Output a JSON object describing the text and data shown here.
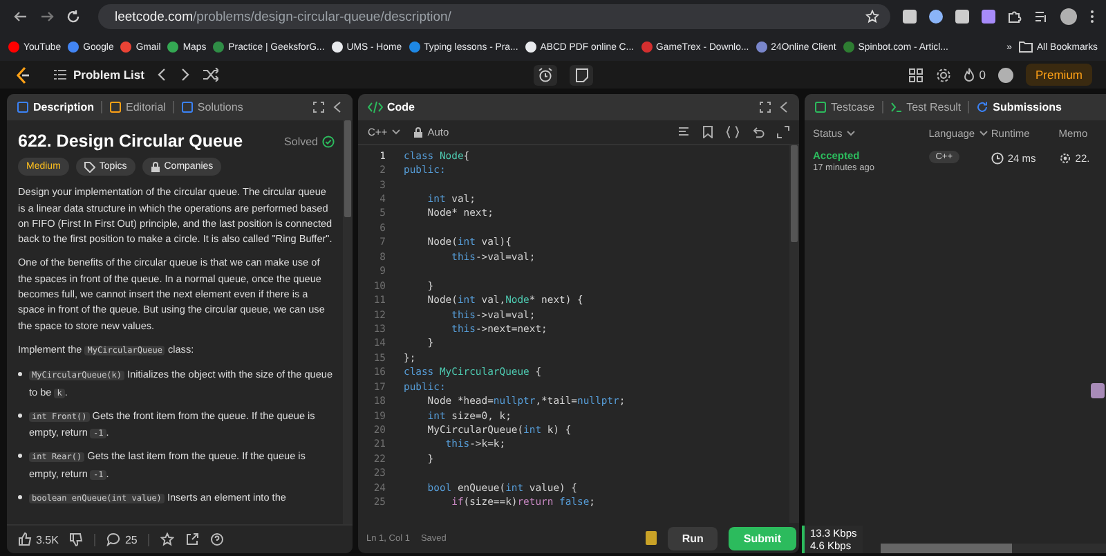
{
  "browser": {
    "url_host": "leetcode.com",
    "url_path": "/problems/design-circular-queue/description/",
    "bookmarks": [
      {
        "label": "YouTube",
        "color": "#ff0000"
      },
      {
        "label": "Google",
        "color": "#4285f4"
      },
      {
        "label": "Gmail",
        "color": "#ea4335"
      },
      {
        "label": "Maps",
        "color": "#34a853"
      },
      {
        "label": "Practice | GeeksforG...",
        "color": "#2f8d46"
      },
      {
        "label": "UMS - Home",
        "color": "#e8eaed"
      },
      {
        "label": "Typing lessons - Pra...",
        "color": "#1e88e5"
      },
      {
        "label": "ABCD PDF online C...",
        "color": "#e8eaed"
      },
      {
        "label": "GameTrex - Downlo...",
        "color": "#d32f2f"
      },
      {
        "label": "24Online Client",
        "color": "#7986cb"
      },
      {
        "label": "Spinbot.com - Articl...",
        "color": "#2e7d32"
      }
    ],
    "more": "»",
    "all_bookmarks": "All Bookmarks"
  },
  "nav": {
    "problem_list": "Problem List",
    "streak": "0",
    "premium": "Premium"
  },
  "description": {
    "tabs": [
      {
        "label": "Description",
        "selected": true
      },
      {
        "label": "Editorial",
        "selected": false
      },
      {
        "label": "Solutions",
        "selected": false
      }
    ],
    "title": "622. Design Circular Queue",
    "status": "Solved",
    "tags": [
      {
        "label": "Medium",
        "kind": "difficulty"
      },
      {
        "label": "Topics",
        "kind": "topics"
      },
      {
        "label": "Companies",
        "kind": "companies"
      }
    ],
    "blocks": [
      {
        "kind": "p",
        "parts": [
          {
            "t": "Design your implementation of the circular queue. The circular queue is a linear data structure in which the operations are performed based on FIFO (First In First Out) principle, and the last position is connected back to the first position to make a circle. It is also called \"Ring Buffer\".",
            "kind": "text"
          }
        ]
      },
      {
        "kind": "p",
        "parts": [
          {
            "t": "One of the benefits of the circular queue is that we can make use of the spaces in front of the queue. In a normal queue, once the queue becomes full, we cannot insert the next element even if there is a space in front of the queue. But using the circular queue, we can use the space to store new values.",
            "kind": "text"
          }
        ]
      },
      {
        "kind": "p",
        "parts": [
          {
            "t": "Implement the ",
            "kind": "text"
          },
          {
            "t": "MyCircularQueue",
            "kind": "code"
          },
          {
            "t": " class:",
            "kind": "text"
          }
        ]
      },
      {
        "kind": "li",
        "parts": [
          {
            "t": "MyCircularQueue(k)",
            "kind": "code"
          },
          {
            "t": " Initializes the object with the size of the queue to be ",
            "kind": "text"
          },
          {
            "t": "k",
            "kind": "code"
          },
          {
            "t": ".",
            "kind": "text"
          }
        ]
      },
      {
        "kind": "li",
        "parts": [
          {
            "t": "int Front()",
            "kind": "code"
          },
          {
            "t": " Gets the front item from the queue. If the queue is empty, return ",
            "kind": "text"
          },
          {
            "t": "-1",
            "kind": "code"
          },
          {
            "t": ".",
            "kind": "text"
          }
        ]
      },
      {
        "kind": "li",
        "parts": [
          {
            "t": "int Rear()",
            "kind": "code"
          },
          {
            "t": " Gets the last item from the queue. If the queue is empty, return ",
            "kind": "text"
          },
          {
            "t": "-1",
            "kind": "code"
          },
          {
            "t": ".",
            "kind": "text"
          }
        ]
      },
      {
        "kind": "li",
        "parts": [
          {
            "t": "boolean enQueue(int value)",
            "kind": "code"
          },
          {
            "t": " Inserts an element into the",
            "kind": "text"
          }
        ]
      }
    ],
    "likes": "3.5K",
    "comments": "25"
  },
  "code": {
    "title": "Code",
    "language": "C++",
    "mode": "Auto",
    "lines": [
      {
        "n": "1",
        "selected": true,
        "tokens": [
          {
            "t": "class ",
            "kind": "kw"
          },
          {
            "t": "Node",
            "kind": "type"
          },
          {
            "t": "{",
            "kind": "p"
          }
        ]
      },
      {
        "n": "2",
        "selected": false,
        "tokens": [
          {
            "t": "public:",
            "kind": "kw"
          }
        ]
      },
      {
        "n": "3",
        "selected": false
      },
      {
        "n": "4",
        "selected": false,
        "tokens": [
          {
            "t": "    int ",
            "kind": "kw"
          },
          {
            "t": "val;",
            "kind": "p"
          }
        ]
      },
      {
        "n": "5",
        "selected": false,
        "tokens": [
          {
            "t": "    Node* next;",
            "kind": "p"
          }
        ]
      },
      {
        "n": "6",
        "selected": false
      },
      {
        "n": "7",
        "selected": false,
        "tokens": [
          {
            "t": "    Node(",
            "kind": "p"
          },
          {
            "t": "int ",
            "kind": "kw"
          },
          {
            "t": "val){",
            "kind": "p"
          }
        ]
      },
      {
        "n": "8",
        "selected": false,
        "tokens": [
          {
            "t": "        this",
            "kind": "kw"
          },
          {
            "t": "->val=val;",
            "kind": "p"
          }
        ]
      },
      {
        "n": "9",
        "selected": false
      },
      {
        "n": "10",
        "selected": false,
        "tokens": [
          {
            "t": "    }",
            "kind": "p"
          }
        ]
      },
      {
        "n": "11",
        "selected": false,
        "tokens": [
          {
            "t": "    Node(",
            "kind": "p"
          },
          {
            "t": "int ",
            "kind": "kw"
          },
          {
            "t": "val,",
            "kind": "p"
          },
          {
            "t": "Node",
            "kind": "type"
          },
          {
            "t": "* next) {",
            "kind": "p"
          }
        ]
      },
      {
        "n": "12",
        "selected": false,
        "tokens": [
          {
            "t": "        this",
            "kind": "kw"
          },
          {
            "t": "->val=val;",
            "kind": "p"
          }
        ]
      },
      {
        "n": "13",
        "selected": false,
        "tokens": [
          {
            "t": "        this",
            "kind": "kw"
          },
          {
            "t": "->next=next;",
            "kind": "p"
          }
        ]
      },
      {
        "n": "14",
        "selected": false,
        "tokens": [
          {
            "t": "    }",
            "kind": "p"
          }
        ]
      },
      {
        "n": "15",
        "selected": false,
        "tokens": [
          {
            "t": "};",
            "kind": "p"
          }
        ]
      },
      {
        "n": "16",
        "selected": false,
        "tokens": [
          {
            "t": "class ",
            "kind": "kw"
          },
          {
            "t": "MyCircularQueue",
            "kind": "type"
          },
          {
            "t": " {",
            "kind": "p"
          }
        ]
      },
      {
        "n": "17",
        "selected": false,
        "tokens": [
          {
            "t": "public:",
            "kind": "kw"
          }
        ]
      },
      {
        "n": "18",
        "selected": false,
        "tokens": [
          {
            "t": "    Node *head=",
            "kind": "p"
          },
          {
            "t": "nullptr",
            "kind": "kw"
          },
          {
            "t": ",*tail=",
            "kind": "p"
          },
          {
            "t": "nullptr",
            "kind": "kw"
          },
          {
            "t": ";",
            "kind": "p"
          }
        ]
      },
      {
        "n": "19",
        "selected": false,
        "tokens": [
          {
            "t": "    int ",
            "kind": "kw"
          },
          {
            "t": "size=0, k;",
            "kind": "p"
          }
        ]
      },
      {
        "n": "20",
        "selected": false,
        "tokens": [
          {
            "t": "    MyCircularQueue(",
            "kind": "p"
          },
          {
            "t": "int ",
            "kind": "kw"
          },
          {
            "t": "k) {",
            "kind": "p"
          }
        ]
      },
      {
        "n": "21",
        "selected": false,
        "tokens": [
          {
            "t": "       this",
            "kind": "kw"
          },
          {
            "t": "->k=k;",
            "kind": "p"
          }
        ]
      },
      {
        "n": "22",
        "selected": false,
        "tokens": [
          {
            "t": "    }",
            "kind": "p"
          }
        ]
      },
      {
        "n": "23",
        "selected": false
      },
      {
        "n": "24",
        "selected": false,
        "tokens": [
          {
            "t": "    bool ",
            "kind": "kw"
          },
          {
            "t": "enQueue(",
            "kind": "p"
          },
          {
            "t": "int ",
            "kind": "kw"
          },
          {
            "t": "value) {",
            "kind": "p"
          }
        ]
      },
      {
        "n": "25",
        "selected": false,
        "tokens": [
          {
            "t": "        if",
            "kind": "ctrl"
          },
          {
            "t": "(size==k)",
            "kind": "p"
          },
          {
            "t": "return ",
            "kind": "ctrl"
          },
          {
            "t": "false",
            "kind": "kw"
          },
          {
            "t": ";",
            "kind": "p"
          }
        ]
      }
    ],
    "cursor": "Ln 1, Col 1",
    "saved": "Saved",
    "run": "Run",
    "submit": "Submit"
  },
  "results": {
    "tabs": [
      {
        "label": "Testcase",
        "selected": false
      },
      {
        "label": "Test Result",
        "selected": false
      },
      {
        "label": "Submissions",
        "selected": true
      }
    ],
    "columns": [
      "Status",
      "Language",
      "Runtime",
      "Memo"
    ],
    "rows": [
      {
        "status": "Accepted",
        "time": "17 minutes ago",
        "language": "C++",
        "runtime": "24 ms",
        "memory": "22."
      }
    ]
  },
  "net_speed": {
    "down": "13.3 Kbps",
    "up": "4.6 Kbps"
  }
}
